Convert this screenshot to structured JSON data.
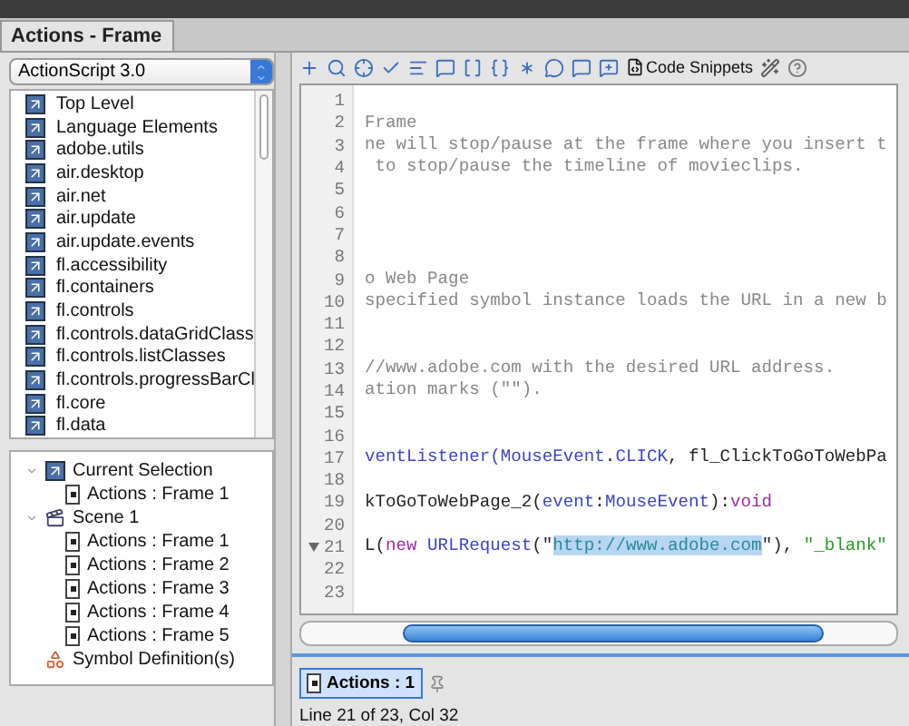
{
  "window": {
    "title": "Actions - Frame"
  },
  "language_select": {
    "value": "ActionScript 3.0"
  },
  "library": [
    {
      "label": "Top Level"
    },
    {
      "label": "Language Elements"
    },
    {
      "label": "adobe.utils"
    },
    {
      "label": "air.desktop"
    },
    {
      "label": "air.net"
    },
    {
      "label": "air.update"
    },
    {
      "label": "air.update.events"
    },
    {
      "label": "fl.accessibility"
    },
    {
      "label": "fl.containers"
    },
    {
      "label": "fl.controls"
    },
    {
      "label": "fl.controls.dataGridClass"
    },
    {
      "label": "fl.controls.listClasses"
    },
    {
      "label": "fl.controls.progressBarCl"
    },
    {
      "label": "fl.core"
    },
    {
      "label": "fl.data"
    }
  ],
  "script_tree": [
    {
      "label": "Current Selection",
      "kind": "selection",
      "expanded": true,
      "children": [
        {
          "label": "Actions : Frame 1",
          "kind": "frame"
        }
      ]
    },
    {
      "label": "Scene 1",
      "kind": "scene",
      "expanded": true,
      "children": [
        {
          "label": "Actions : Frame 1",
          "kind": "frame"
        },
        {
          "label": "Actions : Frame 2",
          "kind": "frame"
        },
        {
          "label": "Actions : Frame 3",
          "kind": "frame"
        },
        {
          "label": "Actions : Frame 4",
          "kind": "frame"
        },
        {
          "label": "Actions : Frame 5",
          "kind": "frame"
        }
      ]
    },
    {
      "label": "Symbol Definition(s)",
      "kind": "symbols"
    }
  ],
  "toolbar": {
    "code_snippets": "Code Snippets"
  },
  "code_lines": [
    {
      "number": "1"
    },
    {
      "number": "2",
      "tokens": [
        {
          "text": "Frame",
          "kind": "comment"
        }
      ]
    },
    {
      "number": "3",
      "tokens": [
        {
          "text": "ne will stop/pause at the frame where you insert t",
          "kind": "comment"
        }
      ]
    },
    {
      "number": "4",
      "tokens": [
        {
          "text": " to stop/pause the timeline of movieclips.",
          "kind": "comment"
        }
      ]
    },
    {
      "number": "5"
    },
    {
      "number": "6"
    },
    {
      "number": "7"
    },
    {
      "number": "8"
    },
    {
      "number": "9",
      "tokens": [
        {
          "text": "o Web Page",
          "kind": "comment"
        }
      ]
    },
    {
      "number": "10",
      "tokens": [
        {
          "text": "specified symbol instance loads the URL in a new b",
          "kind": "comment"
        }
      ]
    },
    {
      "number": "11"
    },
    {
      "number": "12"
    },
    {
      "number": "13",
      "tokens": [
        {
          "text": "//www.adobe.com with the desired URL address.",
          "kind": "comment"
        }
      ]
    },
    {
      "number": "14",
      "tokens": [
        {
          "text": "ation marks (\"\").",
          "kind": "comment"
        }
      ]
    },
    {
      "number": "15"
    },
    {
      "number": "16"
    },
    {
      "number": "17",
      "tokens": [
        {
          "text": "ventListener(",
          "kind": "type"
        },
        {
          "text": "MouseEvent",
          "kind": "type"
        },
        {
          "text": ".",
          "kind": "plain"
        },
        {
          "text": "CLICK",
          "kind": "type"
        },
        {
          "text": ", fl_ClickToGoToWebPa",
          "kind": "plain"
        }
      ]
    },
    {
      "number": "18"
    },
    {
      "number": "19",
      "tokens": [
        {
          "text": "kToGoToWebPage_2(",
          "kind": "plain"
        },
        {
          "text": "event",
          "kind": "type"
        },
        {
          "text": ":",
          "kind": "plain"
        },
        {
          "text": "MouseEvent",
          "kind": "type"
        },
        {
          "text": "):",
          "kind": "plain"
        },
        {
          "text": "void",
          "kind": "keyword"
        }
      ]
    },
    {
      "number": "20"
    },
    {
      "number": "21",
      "collapsible": true,
      "tokens": [
        {
          "text": "L(",
          "kind": "plain"
        },
        {
          "text": "new",
          "kind": "keyword"
        },
        {
          "text": " URLRequest",
          "kind": "type"
        },
        {
          "text": "(\"",
          "kind": "plain"
        },
        {
          "text": "http://www.adobe.com",
          "kind": "selected"
        },
        {
          "text": "\"), ",
          "kind": "plain"
        },
        {
          "text": "\"_blank\"",
          "kind": "string"
        }
      ]
    },
    {
      "number": "22"
    },
    {
      "number": "23"
    }
  ],
  "script_tabs": [
    {
      "label": "Actions : 1",
      "selected": true
    }
  ],
  "status_bar": "Line 21 of 23, Col 32"
}
